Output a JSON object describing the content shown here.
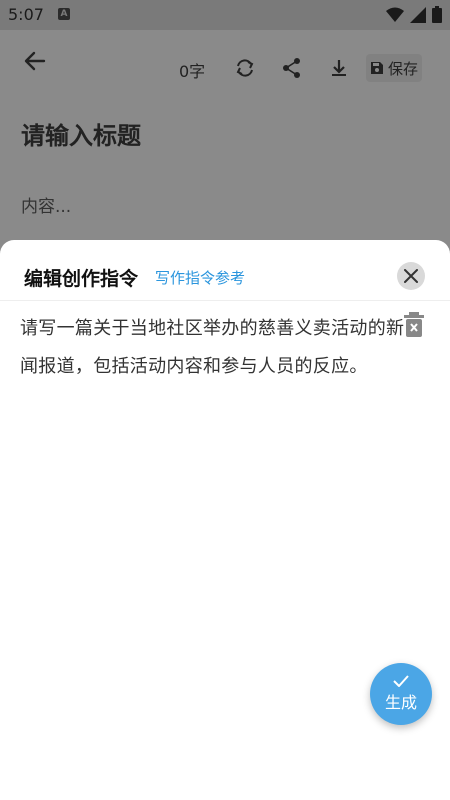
{
  "status_bar": {
    "time": "5:07",
    "app_icon_letter": "A",
    "icons": [
      "wifi-icon",
      "signal-icon",
      "battery-icon"
    ]
  },
  "toolbar": {
    "char_count": "0字",
    "save_label": "保存",
    "icons": [
      "back-arrow-icon",
      "sync-icon",
      "share-icon",
      "download-icon",
      "save-disk-icon"
    ]
  },
  "editor": {
    "title_placeholder": "请输入标题",
    "content_placeholder": "内容..."
  },
  "sheet": {
    "title": "编辑创作指令",
    "reference_link": "写作指令参考",
    "prompt": "请写一篇关于当地社区举办的慈善义卖活动的新闻报道，包括活动内容和参与人员的反应。"
  },
  "fab": {
    "label": "生成"
  },
  "colors": {
    "accent": "#2a95dd",
    "fab": "#4ba6e6",
    "overlay": "#8a8a8a"
  }
}
